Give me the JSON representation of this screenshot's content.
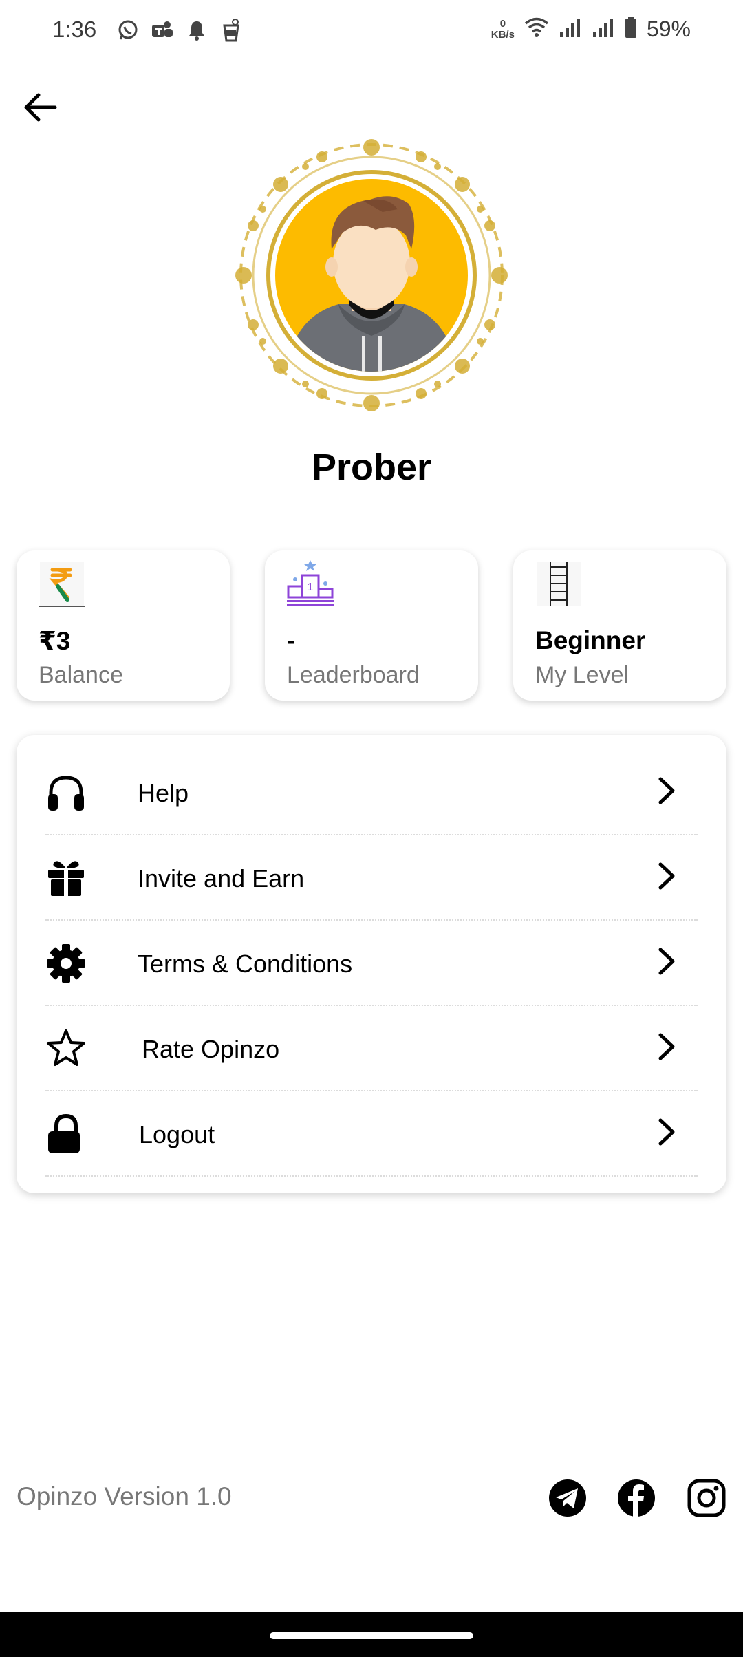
{
  "status_bar": {
    "time": "1:36",
    "net_speed_value": "0",
    "net_speed_unit": "KB/s",
    "battery": "59%"
  },
  "profile": {
    "name": "Prober"
  },
  "stats": [
    {
      "value": "₹3",
      "label": "Balance",
      "icon": "rupee-icon"
    },
    {
      "value": "-",
      "label": "Leaderboard",
      "icon": "podium-icon"
    },
    {
      "value": "Beginner",
      "label": "My Level",
      "icon": "ladder-icon"
    }
  ],
  "menu": {
    "items": [
      {
        "label": "Help",
        "icon": "headphones-icon"
      },
      {
        "label": "Invite and Earn",
        "icon": "gift-icon"
      },
      {
        "label": "Terms & Conditions",
        "icon": "gear-icon"
      },
      {
        "label": "Rate Opinzo",
        "icon": "star-icon"
      },
      {
        "label": "Logout",
        "icon": "lock-icon"
      }
    ]
  },
  "footer": {
    "version": "Opinzo Version 1.0",
    "social": [
      "telegram-icon",
      "facebook-icon",
      "instagram-icon"
    ]
  },
  "colors": {
    "avatar_bg": "#FDBB00",
    "gold": "#D4AF37",
    "leaderboard_purple": "#8E44D8"
  }
}
